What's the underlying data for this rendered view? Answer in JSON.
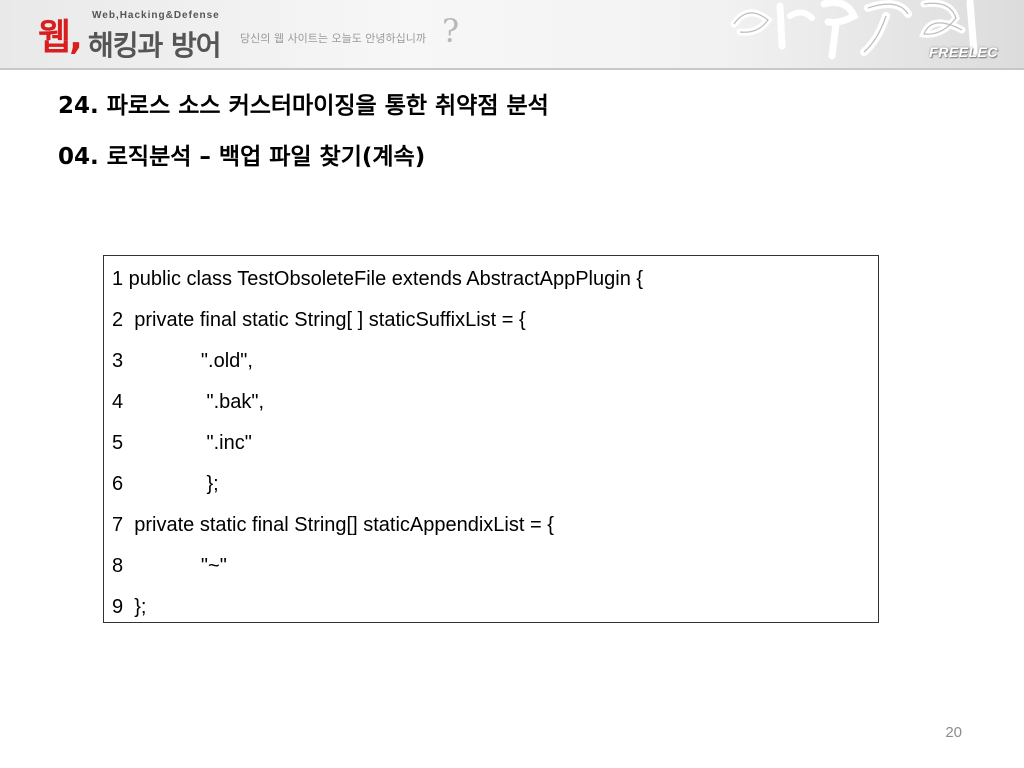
{
  "header": {
    "logo_mark": "웹,",
    "logo_subtitle": "Web,Hacking&Defense",
    "logo_title": "해킹과 방어",
    "tagline": "당신의 웹 사이트는 오늘도 안녕하십니까",
    "tagline_mark": "?",
    "script_text": "열혈강의",
    "publisher": "FREELEC",
    "accent_color": "#d81e1e"
  },
  "slide": {
    "title": "24. 파로스 소스 커스터마이징을 통한 취약점 분석",
    "subtitle": "04. 로직분석 – 백업 파일 찾기(계속)",
    "page_number": "20"
  },
  "code": {
    "lines": [
      {
        "num": "1",
        "text": " public class TestObsoleteFile extends AbstractAppPlugin {"
      },
      {
        "num": "2",
        "text": "  private final static String[ ] staticSuffixList = {"
      },
      {
        "num": "3",
        "text": "              \".old\","
      },
      {
        "num": "4",
        "text": "               \".bak\","
      },
      {
        "num": "5",
        "text": "               \".inc\""
      },
      {
        "num": "6",
        "text": "               };"
      },
      {
        "num": "7",
        "text": "  private static final String[] staticAppendixList = {"
      },
      {
        "num": "8",
        "text": "              \"~\""
      },
      {
        "num": "9",
        "text": "  };"
      }
    ]
  }
}
